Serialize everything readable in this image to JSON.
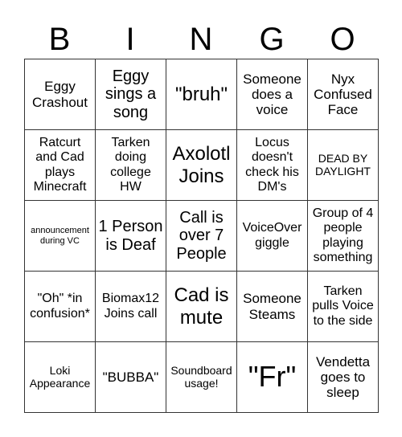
{
  "header": {
    "letters": [
      "B",
      "I",
      "N",
      "G",
      "O"
    ]
  },
  "board": {
    "rows": [
      [
        "Eggy Crashout",
        "Eggy sings a song",
        "\"bruh\"",
        "Someone does a voice",
        "Nyx Confused Face"
      ],
      [
        "Ratcurt and Cad plays Minecraft",
        "Tarken doing college HW",
        "Axolotl Joins",
        "Locus doesn't check his DM's",
        "DEAD BY DAYLIGHT"
      ],
      [
        "announcement during VC",
        "1 Person is Deaf",
        "Call is over 7 People",
        "VoiceOver giggle",
        "Group of 4 people playing something"
      ],
      [
        "\"Oh\" *in confusion*",
        "Biomax12 Joins call",
        "Cad is mute",
        "Someone Steams",
        "Tarken pulls Voice to the side"
      ],
      [
        "Loki Appearance",
        "\"BUBBA\"",
        "Soundboard usage!",
        "\"Fr\"",
        "Vendetta goes to sleep"
      ]
    ]
  }
}
